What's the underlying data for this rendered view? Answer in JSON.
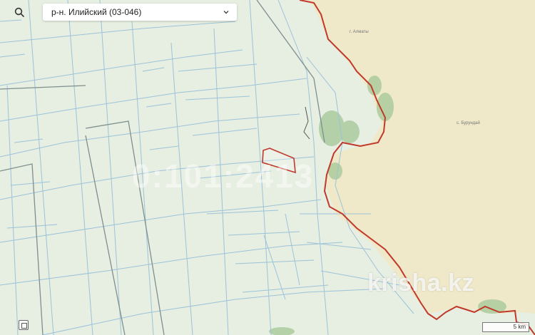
{
  "region_select": {
    "label": "р-н. Илийский (03-046)"
  },
  "watermark": "krisha.kz",
  "faint_overlay": "0:101:2413",
  "scale": {
    "label": "5 km"
  },
  "colors": {
    "background": "#e7eee2",
    "right_zone": "#ede7c8",
    "parcel_line": "#9cc3d9",
    "boundary_red": "#c0392b",
    "green_area": "#a9c99a"
  }
}
